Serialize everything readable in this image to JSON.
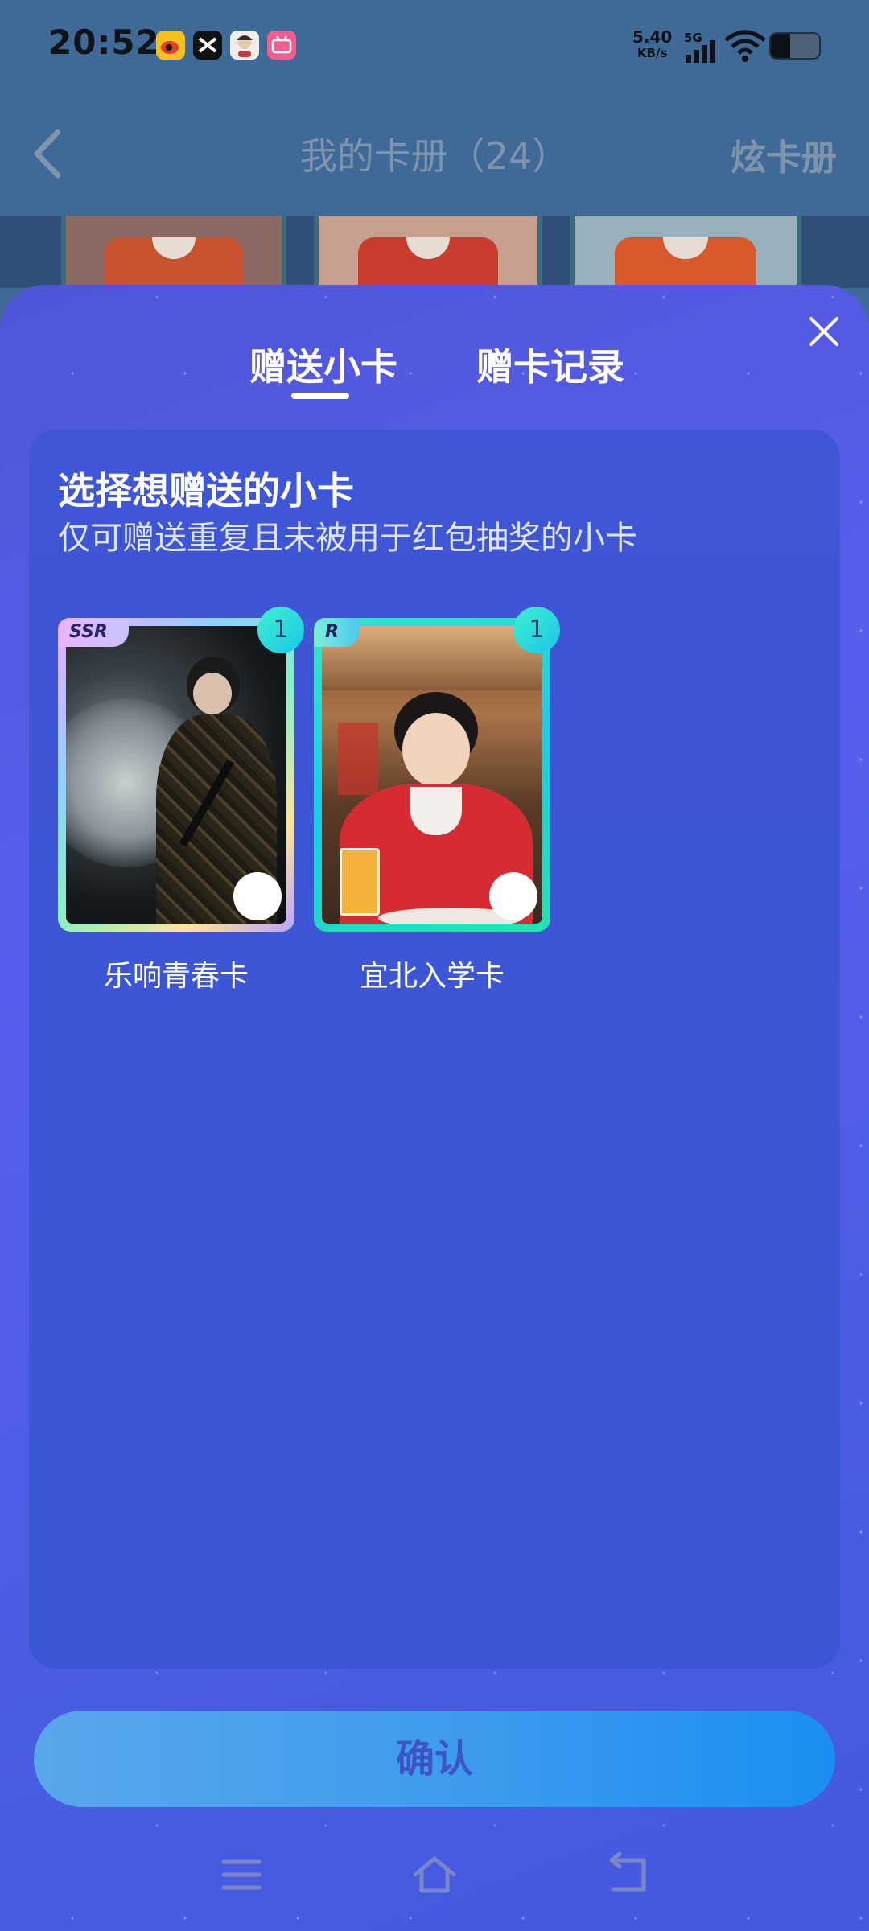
{
  "status_bar": {
    "time": "20:52",
    "net_speed_value": "5.40",
    "net_speed_unit": "KB/s",
    "network_type": "5G",
    "app_icons": [
      "weibo-icon",
      "capcut-icon",
      "avatar-app-icon",
      "bilibili-icon"
    ]
  },
  "nav": {
    "title": "我的卡册（24）",
    "right_action": "炫卡册"
  },
  "sheet": {
    "tabs": [
      {
        "label": "赠送小卡",
        "active": true
      },
      {
        "label": "赠卡记录",
        "active": false
      }
    ],
    "panel": {
      "title": "选择想赠送的小卡",
      "subtitle": "仅可赠送重复且未被用于红包抽奖的小卡"
    },
    "cards": [
      {
        "rarity": "SSR",
        "count": "1",
        "name": "乐响青春卡",
        "selected": false
      },
      {
        "rarity": "R",
        "count": "1",
        "name": "宜北入学卡",
        "selected": false
      }
    ],
    "confirm_label": "确认"
  },
  "colors": {
    "sheet_bg": "#5a5ef0",
    "panel_bg": "#3f56d6",
    "confirm_bg": "#3c9bee",
    "count_badge": "#41f0d2"
  }
}
